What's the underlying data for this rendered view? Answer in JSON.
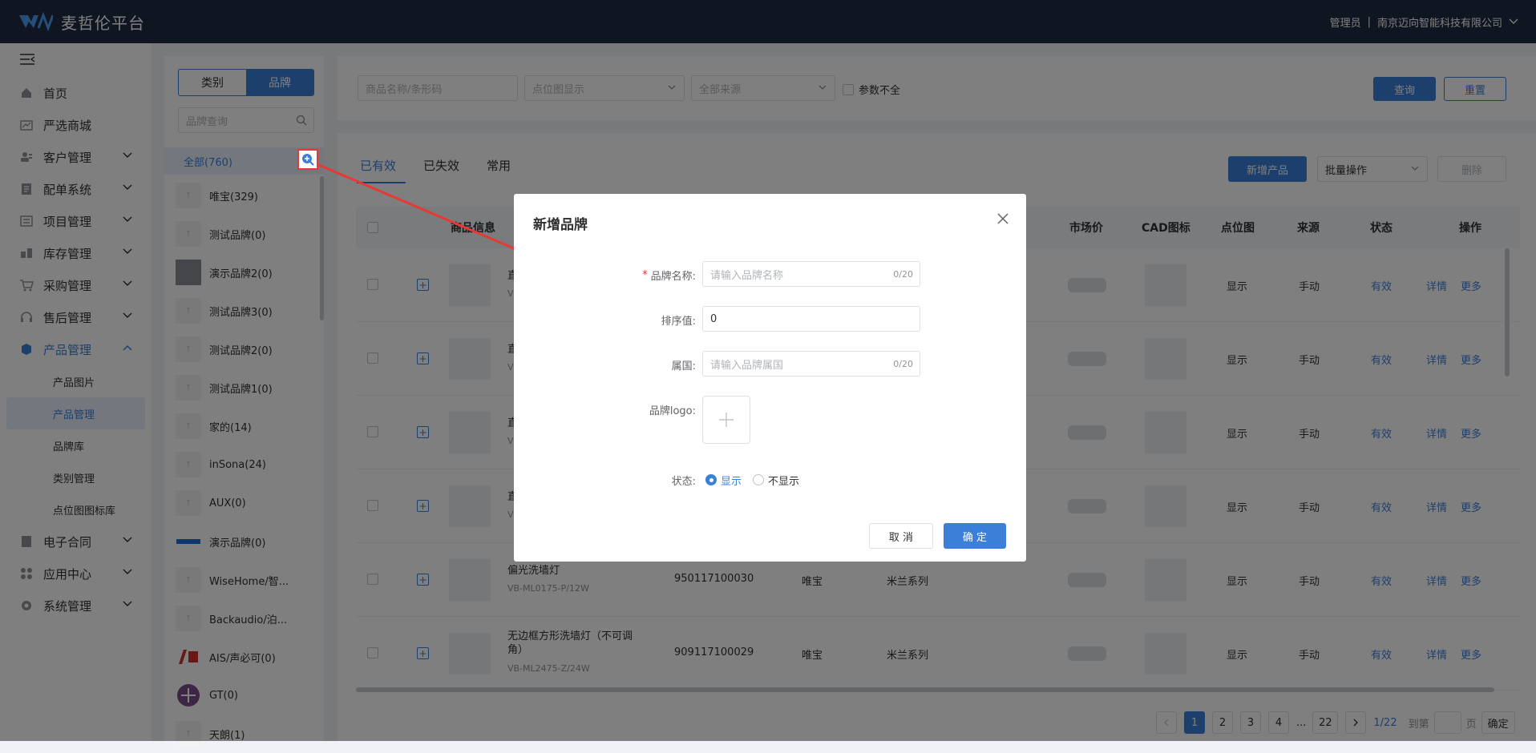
{
  "app": {
    "title": "麦哲伦平台",
    "role": "管理员",
    "company": "南京迈向智能科技有限公司"
  },
  "menu": {
    "items": [
      {
        "label": "首页"
      },
      {
        "label": "严选商城"
      },
      {
        "label": "客户管理"
      },
      {
        "label": "配单系统"
      },
      {
        "label": "项目管理"
      },
      {
        "label": "库存管理"
      },
      {
        "label": "采购管理"
      },
      {
        "label": "售后管理"
      },
      {
        "label": "产品管理"
      }
    ],
    "sub": [
      "产品图片",
      "产品管理",
      "品牌库",
      "类别管理",
      "点位图图标库"
    ],
    "after": [
      "电子合同",
      "应用中心",
      "系统管理"
    ]
  },
  "brandpanel": {
    "seg_category": "类别",
    "seg_brand": "品牌",
    "search_placeholder": "品牌查询",
    "all": "全部(760)",
    "brands": [
      "唯宝(329)",
      "测试品牌(0)",
      "演示品牌2(0)",
      "测试品牌3(0)",
      "测试品牌2(0)",
      "测试品牌1(0)",
      "家的(14)",
      "inSona(24)",
      "AUX(0)",
      "演示品牌(0)",
      "WiseHome/智...",
      "Backaudio/泊...",
      "AIS/声必可(0)",
      "GT(0)",
      "天朗(1)"
    ]
  },
  "filter": {
    "name_placeholder": "商品名称/条形码",
    "point_placeholder": "点位图显示",
    "source_placeholder": "全部来源",
    "incomplete": "参数不全",
    "query": "查询",
    "reset": "重置"
  },
  "main": {
    "tabs": [
      "已有效",
      "已失效",
      "常用"
    ],
    "add_product": "新增产品",
    "batch": "批量操作",
    "delete": "删除",
    "headers": {
      "info": "商品信息",
      "market": "市场价",
      "cad": "CAD图标",
      "point": "点位图",
      "source": "来源",
      "status": "状态",
      "ops": "操作"
    },
    "rows": [
      {
        "name": "直",
        "sku": "V",
        "code": "",
        "brand": "",
        "series": "",
        "point": "显示",
        "source": "手动",
        "status": "有效"
      },
      {
        "name": "直",
        "sku": "V",
        "code": "",
        "brand": "",
        "series": "",
        "point": "显示",
        "source": "手动",
        "status": "有效"
      },
      {
        "name": "直",
        "sku": "V",
        "code": "",
        "brand": "",
        "series": "",
        "point": "显示",
        "source": "手动",
        "status": "有效"
      },
      {
        "name": "直",
        "sku": "V",
        "code": "",
        "brand": "",
        "series": "",
        "point": "显示",
        "source": "手动",
        "status": "有效"
      },
      {
        "name": "偏光洗墙灯",
        "sku": "VB-ML0175-P/12W",
        "code": "950117100030",
        "brand": "唯宝",
        "series": "米兰系列",
        "point": "显示",
        "source": "手动",
        "status": "有效"
      },
      {
        "name": "无边框方形洗墙灯（不可调角）",
        "sku": "VB-ML2475-Z/24W",
        "code": "909117100029",
        "brand": "唯宝",
        "series": "米兰系列",
        "point": "显示",
        "source": "手动",
        "status": "有效"
      }
    ],
    "detail": "详情",
    "more": "更多"
  },
  "pager": {
    "pages": [
      "1",
      "2",
      "3",
      "4",
      "...",
      "22"
    ],
    "total": "1/22",
    "goto": "到第",
    "page_unit": "页",
    "confirm": "确定"
  },
  "modal": {
    "title": "新增品牌",
    "name_label": "品牌名称:",
    "name_placeholder": "请输入品牌名称",
    "name_count": "0/20",
    "sort_label": "排序值:",
    "sort_value": "0",
    "country_label": "属国:",
    "country_placeholder": "请输入品牌属国",
    "country_count": "0/20",
    "logo_label": "品牌logo:",
    "status_label": "状态:",
    "status_show": "显示",
    "status_hide": "不显示",
    "cancel": "取 消",
    "ok": "确 定"
  },
  "colors": {
    "accent": "#3b7fd8",
    "header": "#1f2d44",
    "annotation": "#e53935"
  }
}
